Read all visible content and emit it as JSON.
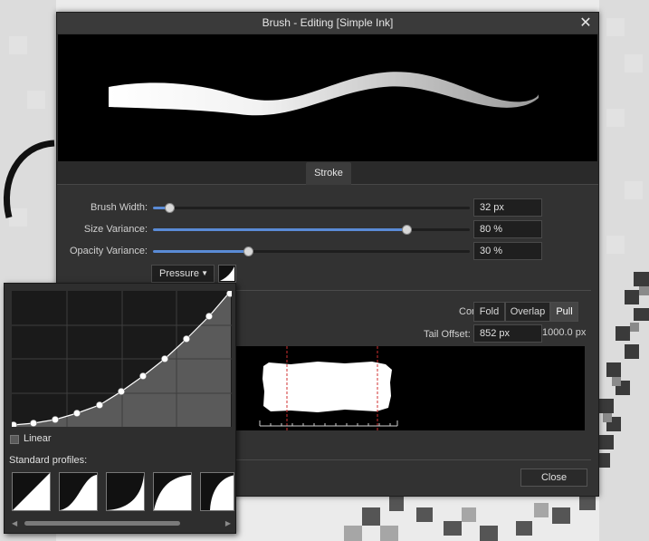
{
  "dialog": {
    "title": "Brush - Editing [Simple Ink]",
    "close_icon": "close-icon"
  },
  "tabs": {
    "stroke": "Stroke"
  },
  "stroke": {
    "brush_width": {
      "label": "Brush Width:",
      "value": "32 px",
      "fraction": 0.05
    },
    "size_variance": {
      "label": "Size Variance:",
      "value": "80 %",
      "fraction": 0.8
    },
    "opacity_variance": {
      "label": "Opacity Variance:",
      "value": "30 %",
      "fraction": 0.3
    },
    "controller": "Pressure"
  },
  "texture": {
    "corners_label": "Corners:",
    "corners_options": [
      "Fold",
      "Overlap",
      "Pull"
    ],
    "corners_selected": "Pull",
    "tail_offset_label": "Tail Offset:",
    "tail_offset_value": "852 px",
    "tail_max": "1000.0 px"
  },
  "footer": {
    "close_label": "Close"
  },
  "pressure_popover": {
    "linear_label": "Linear",
    "linear_checked": false,
    "standard_profiles_label": "Standard profiles:",
    "profile_icons": [
      "profile-linear-icon",
      "profile-s-curve-icon",
      "profile-concave-icon",
      "profile-convex-icon",
      "profile-steep-icon"
    ]
  },
  "colors": {
    "accent": "#5a8bd6",
    "dialog_bg": "#323232",
    "preview_bg": "#000000"
  }
}
